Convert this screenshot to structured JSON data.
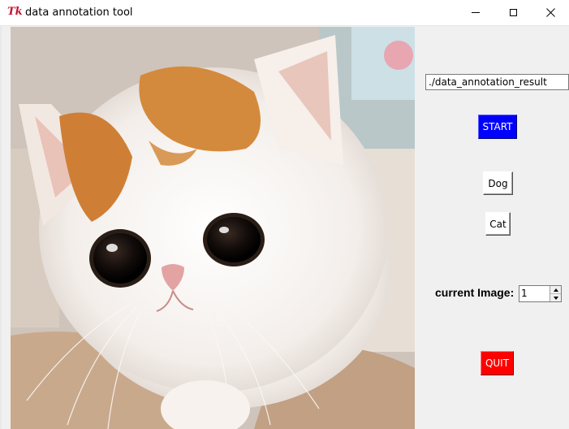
{
  "window": {
    "title": "data annotation tool",
    "icon": "tk-feather-icon",
    "controls": [
      "minimize",
      "maximize",
      "close"
    ]
  },
  "image_viewer": {
    "content": "photo of a white and orange exotic shorthair kitten",
    "subject_label": "kitten"
  },
  "panel": {
    "result_path": "./data_annotation_result",
    "start_label": "START",
    "dog_label": "Dog",
    "cat_label": "Cat",
    "current_image_label": "current Image:",
    "current_image_value": "1",
    "quit_label": "QUIT"
  },
  "colors": {
    "start_button": "#0000ff",
    "quit_button": "#ff0000",
    "window_bg": "#f0f0f0",
    "title_icon": "#c8102e"
  }
}
